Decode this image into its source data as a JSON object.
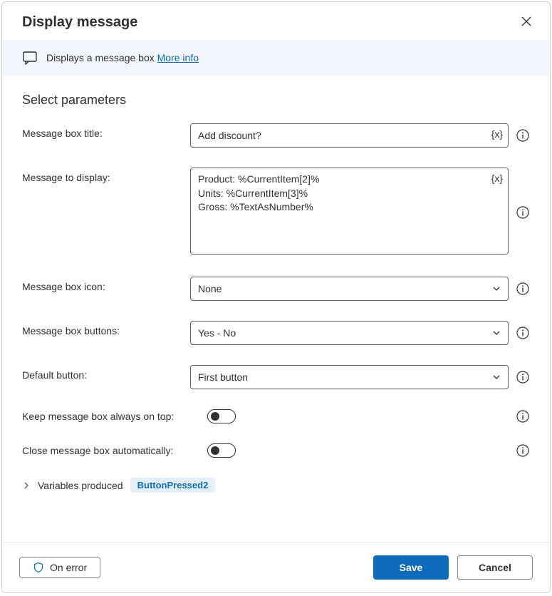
{
  "header": {
    "title": "Display message"
  },
  "infoBar": {
    "text": "Displays a message box ",
    "link": "More info"
  },
  "sectionTitle": "Select parameters",
  "fields": {
    "title": {
      "label": "Message box title:",
      "value": "Add discount?"
    },
    "message": {
      "label": "Message to display:",
      "value": "Product: %CurrentItem[2]%\nUnits: %CurrentItem[3]%\nGross: %TextAsNumber%"
    },
    "icon": {
      "label": "Message box icon:",
      "value": "None"
    },
    "buttons": {
      "label": "Message box buttons:",
      "value": "Yes - No"
    },
    "defaultButton": {
      "label": "Default button:",
      "value": "First button"
    },
    "alwaysOnTop": {
      "label": "Keep message box always on top:"
    },
    "autoClose": {
      "label": "Close message box automatically:"
    }
  },
  "variables": {
    "label": "Variables produced",
    "chip": "ButtonPressed2"
  },
  "footer": {
    "onError": "On error",
    "save": "Save",
    "cancel": "Cancel"
  },
  "icons": {
    "varToken": "{x}"
  }
}
